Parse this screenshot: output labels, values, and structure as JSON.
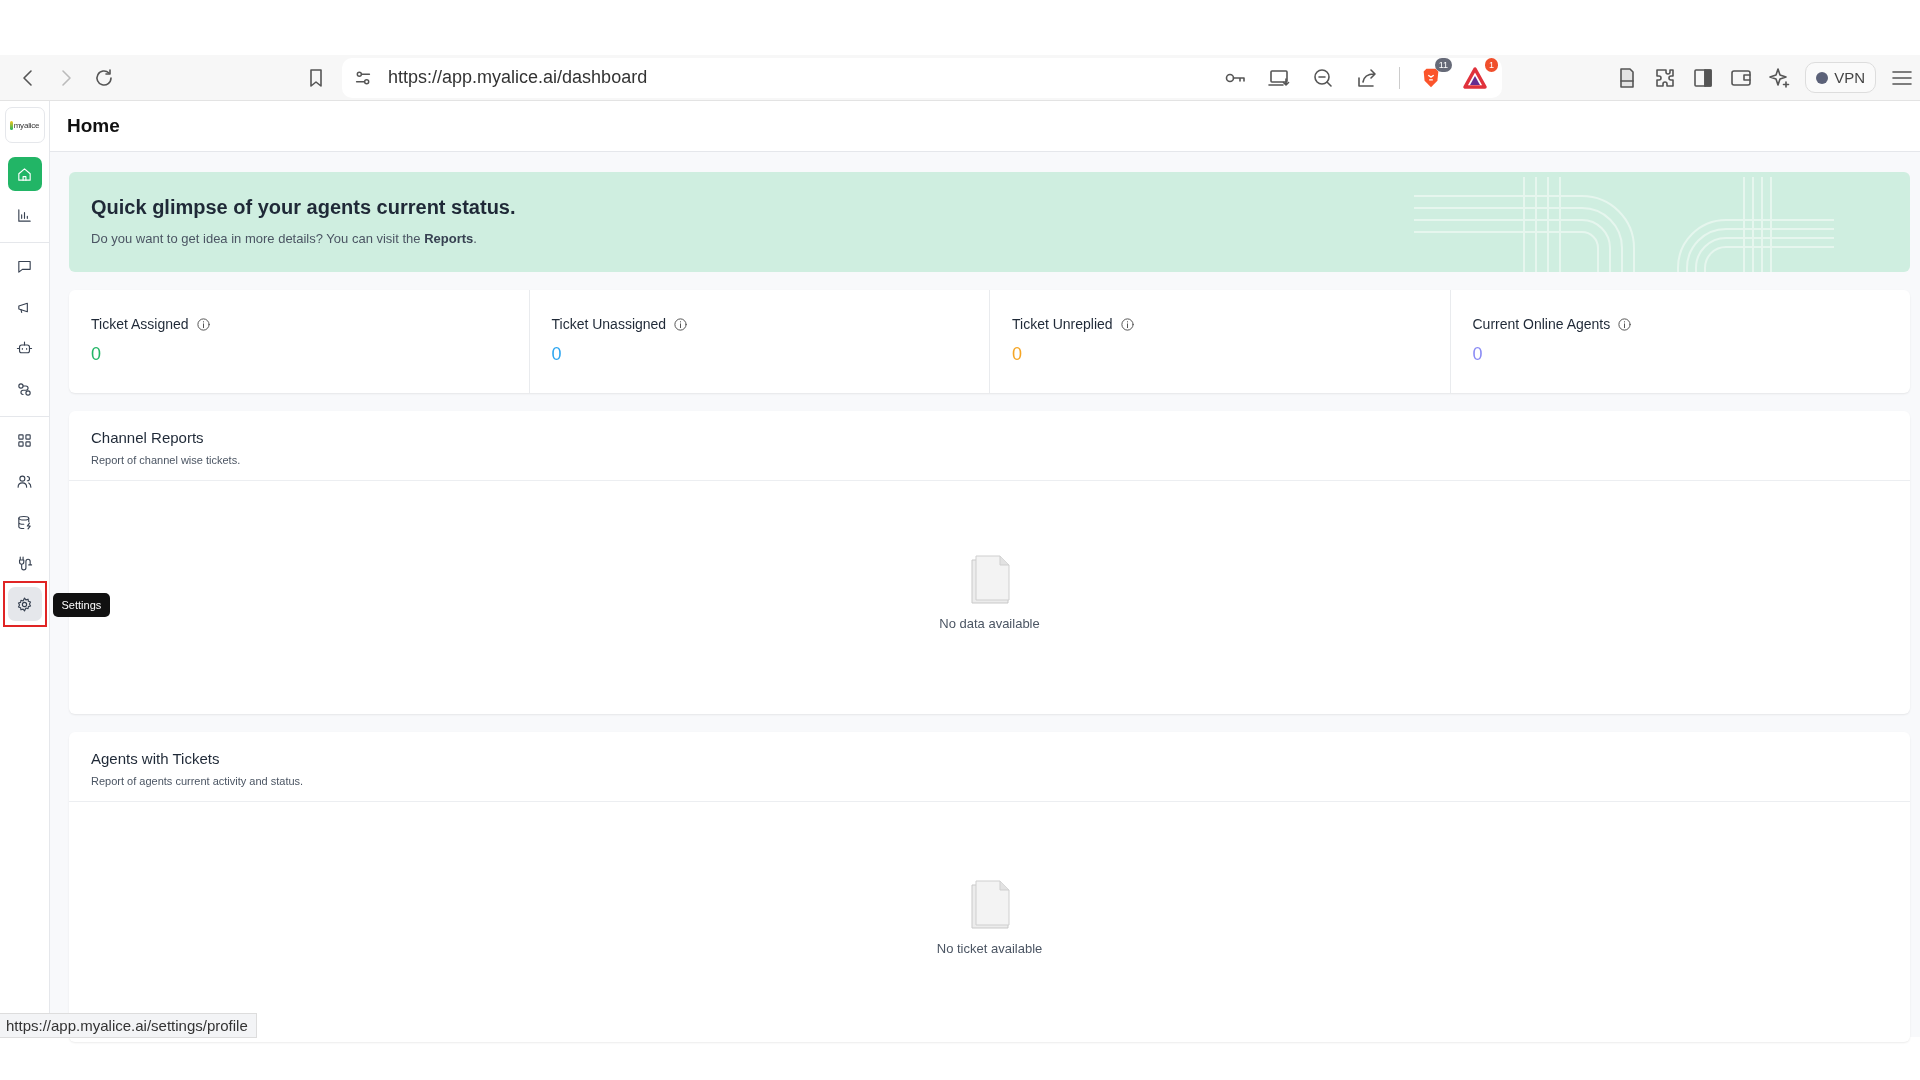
{
  "browser": {
    "url": "https://app.myalice.ai/dashboard",
    "shield_count": "11",
    "rewards_count": "1",
    "vpn_label": "VPN"
  },
  "sidebar": {
    "logo_text": "myalice",
    "groups": [
      [
        {
          "selected": true,
          "hovered": false,
          "highlighted": false
        },
        {
          "selected": false,
          "hovered": false,
          "highlighted": false
        }
      ],
      [
        {
          "selected": false,
          "hovered": false,
          "highlighted": false
        },
        {
          "selected": false,
          "hovered": false,
          "highlighted": false
        },
        {
          "selected": false,
          "hovered": false,
          "highlighted": false
        },
        {
          "selected": false,
          "hovered": false,
          "highlighted": false
        }
      ],
      [
        {
          "selected": false,
          "hovered": false,
          "highlighted": false
        },
        {
          "selected": false,
          "hovered": false,
          "highlighted": false
        },
        {
          "selected": false,
          "hovered": false,
          "highlighted": false
        },
        {
          "selected": false,
          "hovered": false,
          "highlighted": false
        },
        {
          "selected": false,
          "hovered": true,
          "highlighted": true,
          "tooltip": "Settings"
        }
      ]
    ]
  },
  "page_title": "Home",
  "banner": {
    "title": "Quick glimpse of your agents current status.",
    "text": "Do you want to get idea in more details? You can visit the **Reports**."
  },
  "stats": [
    {
      "label": "Ticket Assigned",
      "value": "0",
      "color": "#22b566"
    },
    {
      "label": "Ticket Unassigned",
      "value": "0",
      "color": "#2ea6f0"
    },
    {
      "label": "Ticket Unreplied",
      "value": "0",
      "color": "#f5a524"
    },
    {
      "label": "Current Online Agents",
      "value": "0",
      "color": "#8b8cf5"
    }
  ],
  "reports": [
    {
      "title": "Channel Reports",
      "subtitle": "Report of channel wise tickets.",
      "empty_text": "No data available"
    },
    {
      "title": "Agents with Tickets",
      "subtitle": "Report of agents current activity and status.",
      "empty_text": "No ticket available"
    }
  ],
  "status_url": "https://app.myalice.ai/settings/profile"
}
